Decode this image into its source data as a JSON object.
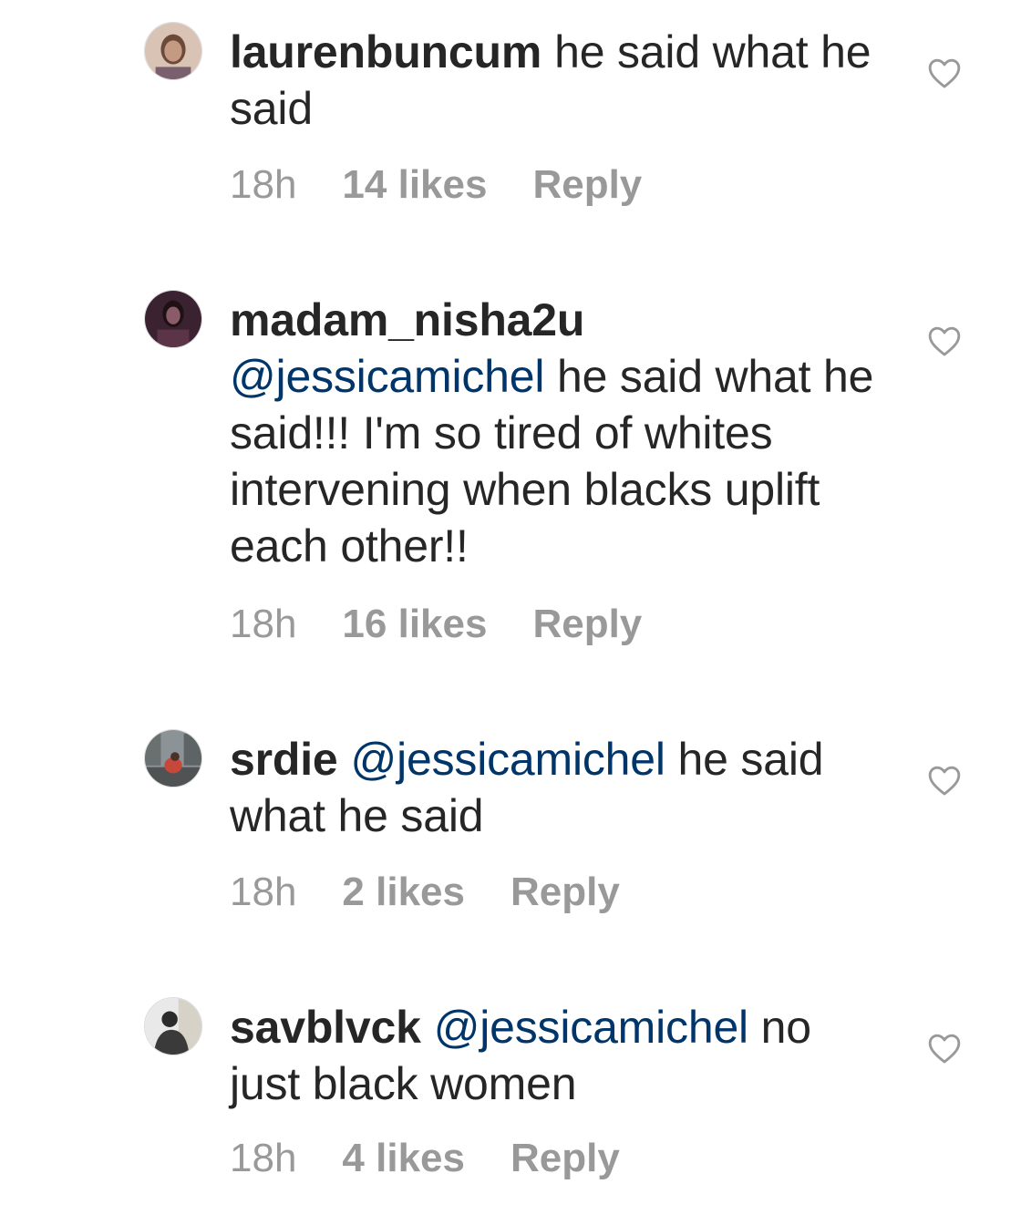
{
  "comments": [
    {
      "username": "laurenbuncum",
      "mention": "",
      "text": "he said what he said",
      "time": "18h",
      "likes": "14 likes",
      "reply": "Reply",
      "avatar_colors": [
        "#d8c3b5",
        "#6b4a3a"
      ]
    },
    {
      "username": "madam_nisha2u",
      "mention": "@jessicamichel",
      "text": "he said what he said!!! I'm so tired of whites intervening when blacks uplift each other!!",
      "time": "18h",
      "likes": "16 likes",
      "reply": "Reply",
      "avatar_colors": [
        "#3a2230",
        "#8a5c6a"
      ]
    },
    {
      "username": "srdie",
      "mention": "@jessicamichel",
      "text": "he said what he said",
      "time": "18h",
      "likes": "2 likes",
      "reply": "Reply",
      "avatar_colors": [
        "#6a6f70",
        "#c5483a"
      ]
    },
    {
      "username": "savblvck",
      "mention": "@jessicamichel",
      "text": "no just black women",
      "time": "18h",
      "likes": "4 likes",
      "reply": "Reply",
      "avatar_colors": [
        "#e9e9e9",
        "#2b2b2b"
      ]
    }
  ],
  "colors": {
    "text": "#262626",
    "mention": "#003569",
    "meta": "#999999",
    "heart": "#999999"
  },
  "icons": {
    "like": "heart-icon"
  }
}
